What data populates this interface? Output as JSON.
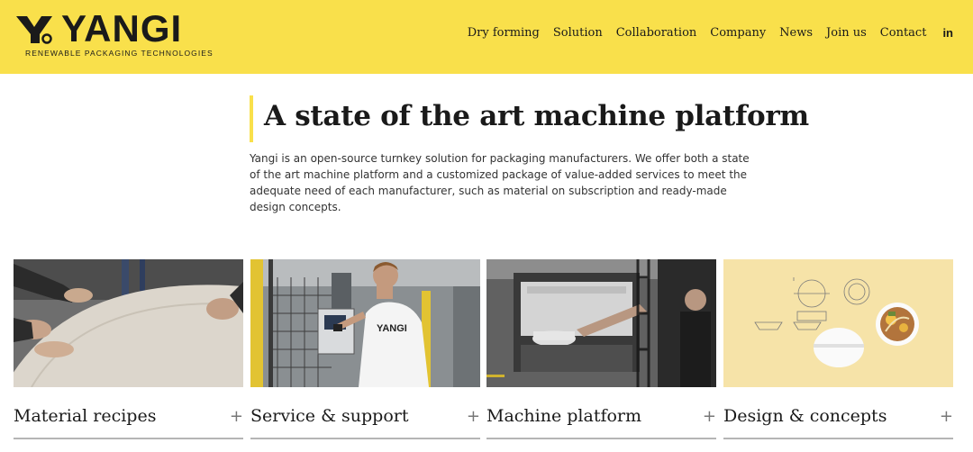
{
  "brand": {
    "name": "YANGI",
    "tagline": "RENEWABLE PACKAGING TECHNOLOGIES"
  },
  "nav": {
    "items": [
      "Dry forming",
      "Solution",
      "Collaboration",
      "Company",
      "News",
      "Join us",
      "Contact"
    ],
    "social": "in"
  },
  "intro": {
    "title": "A state of the art machine platform",
    "text": "Yangi is an open-source turnkey solution for packaging manufacturers. We offer both a state of the art machine platform and a customized package of value-added services to meet the adequate need of each manufacturer, such as material on subscription and ready-made design concepts."
  },
  "cards": [
    {
      "title": "Material recipes",
      "expand": "+"
    },
    {
      "title": "Service & support",
      "expand": "+",
      "shirt_text": "YANGI"
    },
    {
      "title": "Machine platform",
      "expand": "+"
    },
    {
      "title": "Design & concepts",
      "expand": "+"
    }
  ],
  "colors": {
    "brand_yellow": "#f9e04b",
    "text_dark": "#1a1a1a",
    "rule_gray": "#b5b5b5"
  },
  "icons": [
    "yangi-logo-icon",
    "linkedin-icon",
    "plus-icon"
  ]
}
